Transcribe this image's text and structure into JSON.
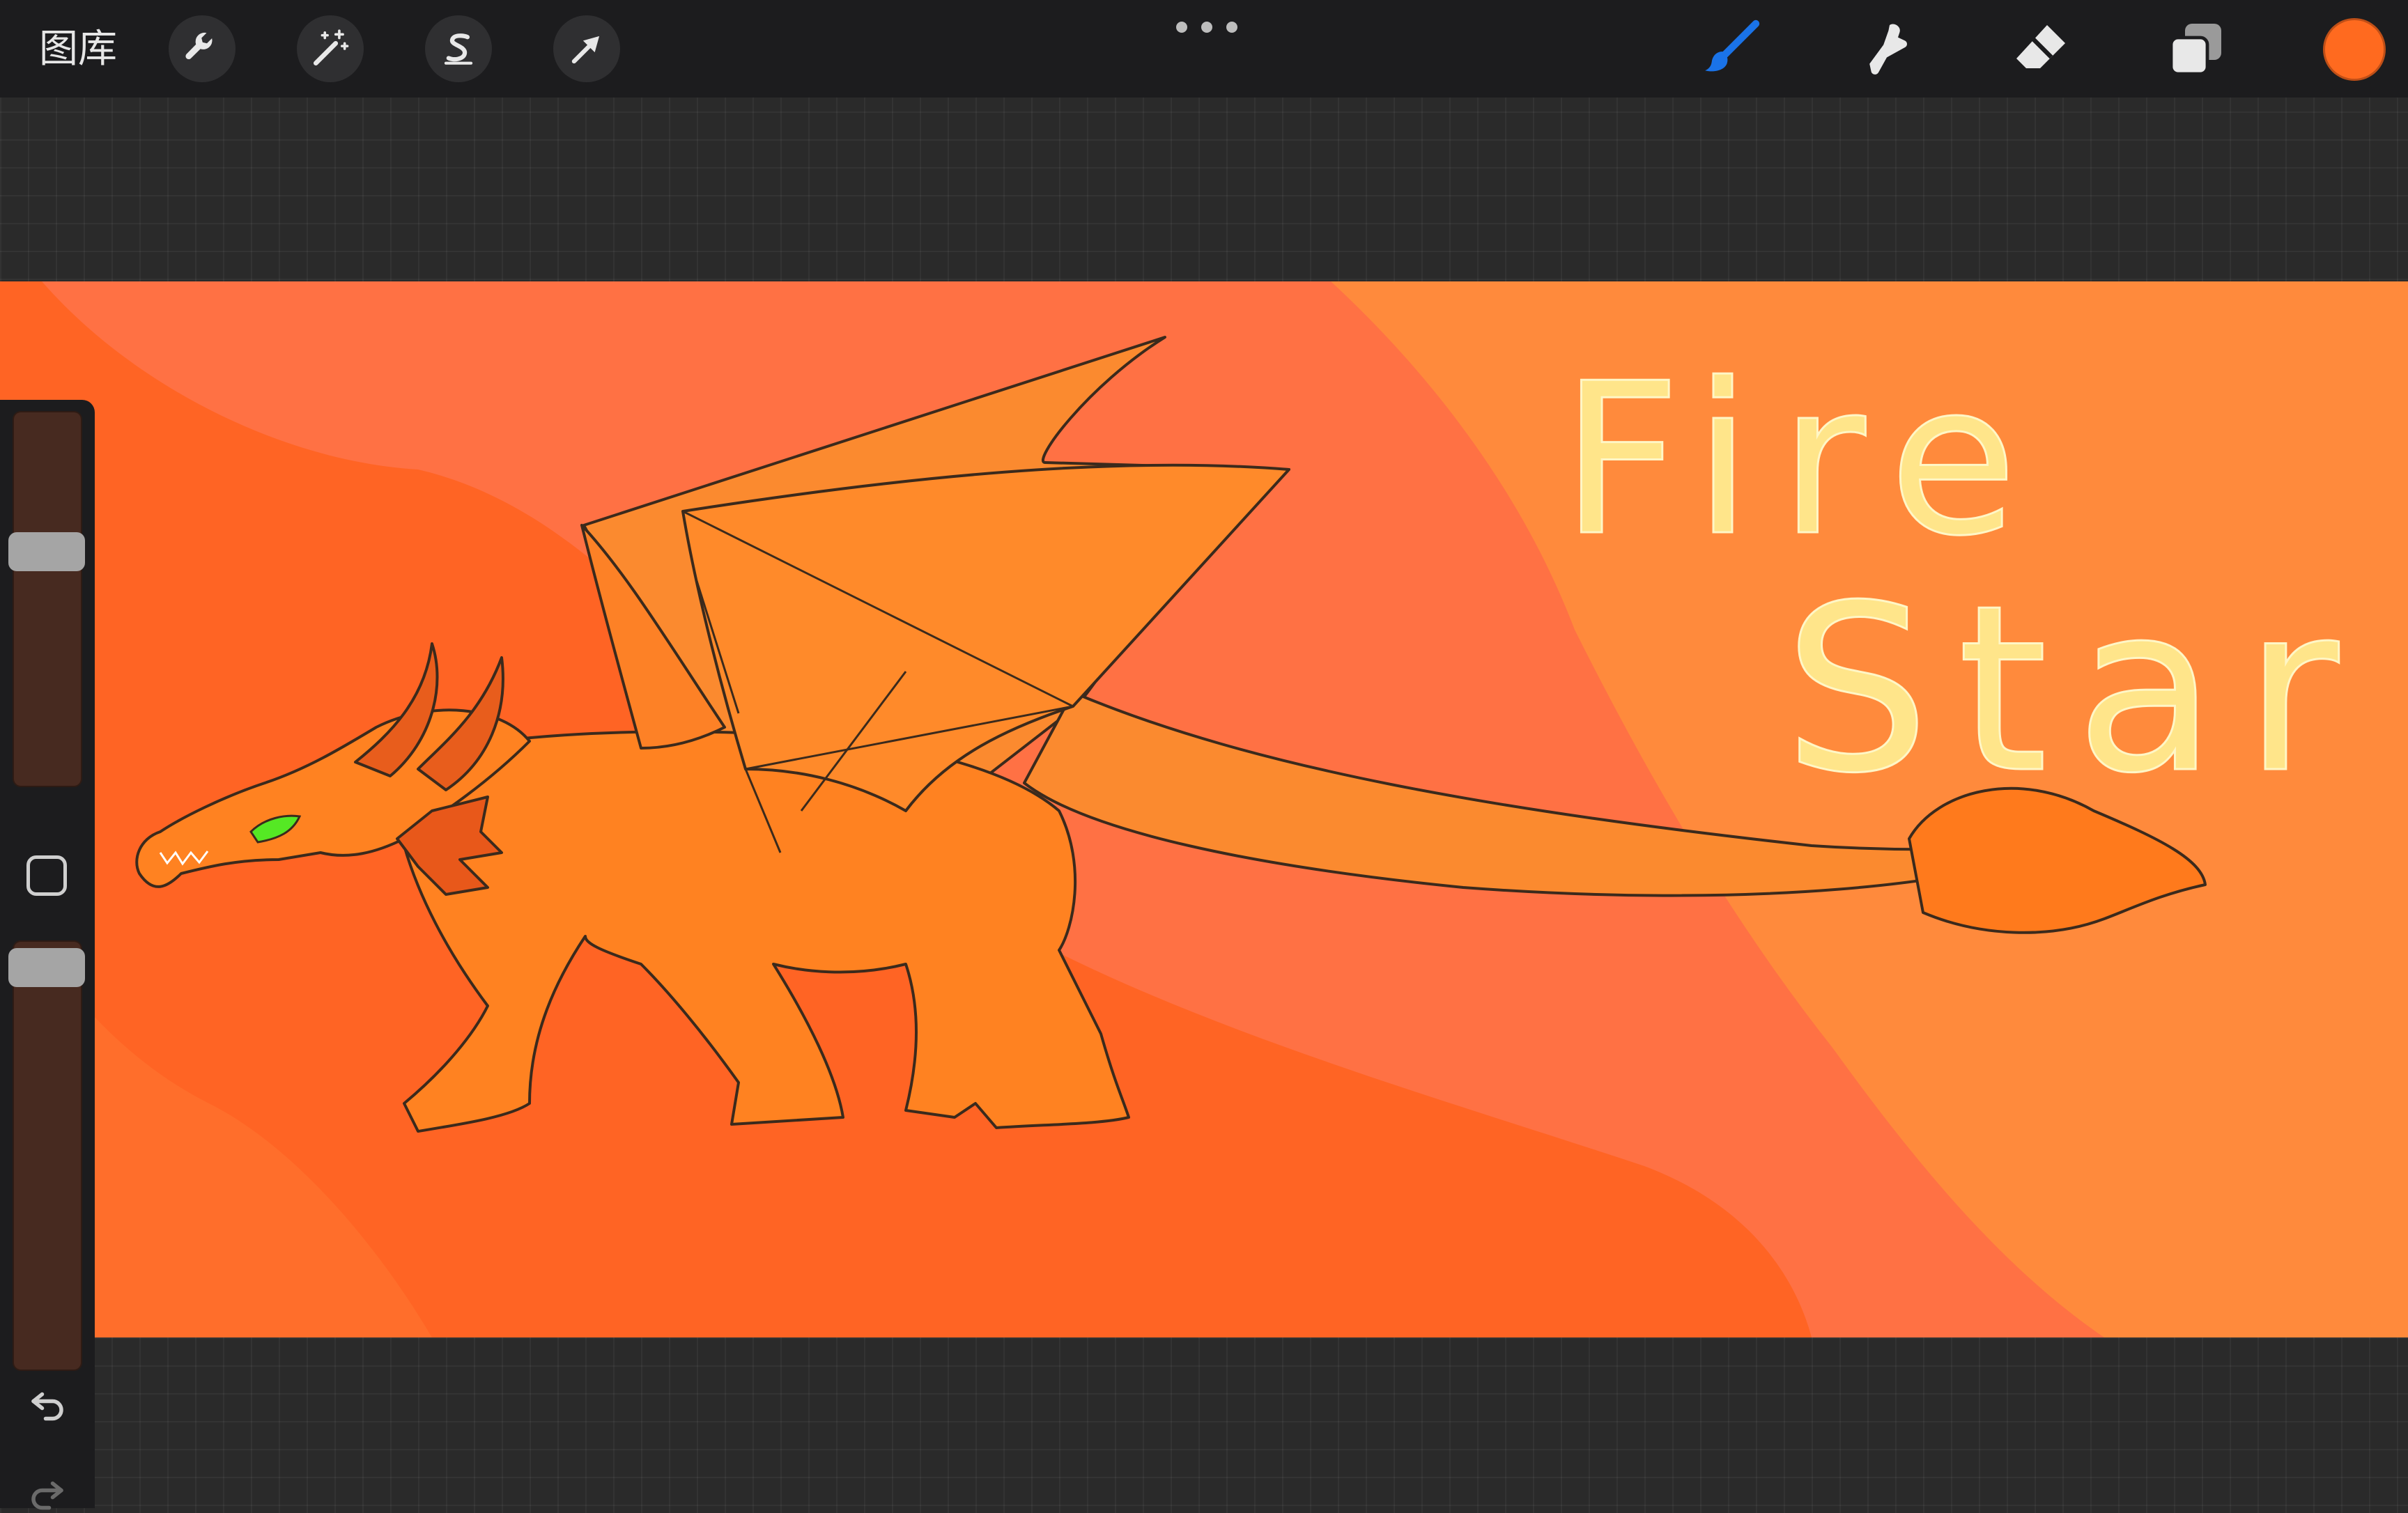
{
  "topbar": {
    "gallery_label": "图库",
    "left_tools": [
      {
        "name": "actions",
        "icon": "wrench-icon"
      },
      {
        "name": "adjustments",
        "icon": "magic-wand-icon"
      },
      {
        "name": "selection",
        "icon": "selection-s-icon"
      },
      {
        "name": "transform",
        "icon": "arrow-cursor-icon"
      }
    ],
    "more_icon": "more-dots-icon",
    "right_tools": [
      {
        "name": "brush",
        "icon": "brush-icon",
        "active": true
      },
      {
        "name": "smudge",
        "icon": "smudge-icon",
        "active": false
      },
      {
        "name": "eraser",
        "icon": "eraser-icon",
        "active": false
      },
      {
        "name": "layers",
        "icon": "layers-icon",
        "active": false
      }
    ],
    "current_color": "#ff6a1f"
  },
  "artwork": {
    "title_line1": "Fire",
    "title_line2": "Star"
  },
  "sidebar": {
    "brush_size_level": 0.64,
    "opacity_level": 0.98,
    "modify_icon": "square-icon",
    "undo_icon": "undo-arrow-icon",
    "redo_icon": "redo-arrow-icon"
  },
  "colors": {
    "accent_blue": "#1a73e8",
    "ui_dark": "#1c1c1e",
    "canvas_bg": "#2a2a2a",
    "orange_main": "#ff6a1f",
    "text_gold": "#ffe58a"
  }
}
